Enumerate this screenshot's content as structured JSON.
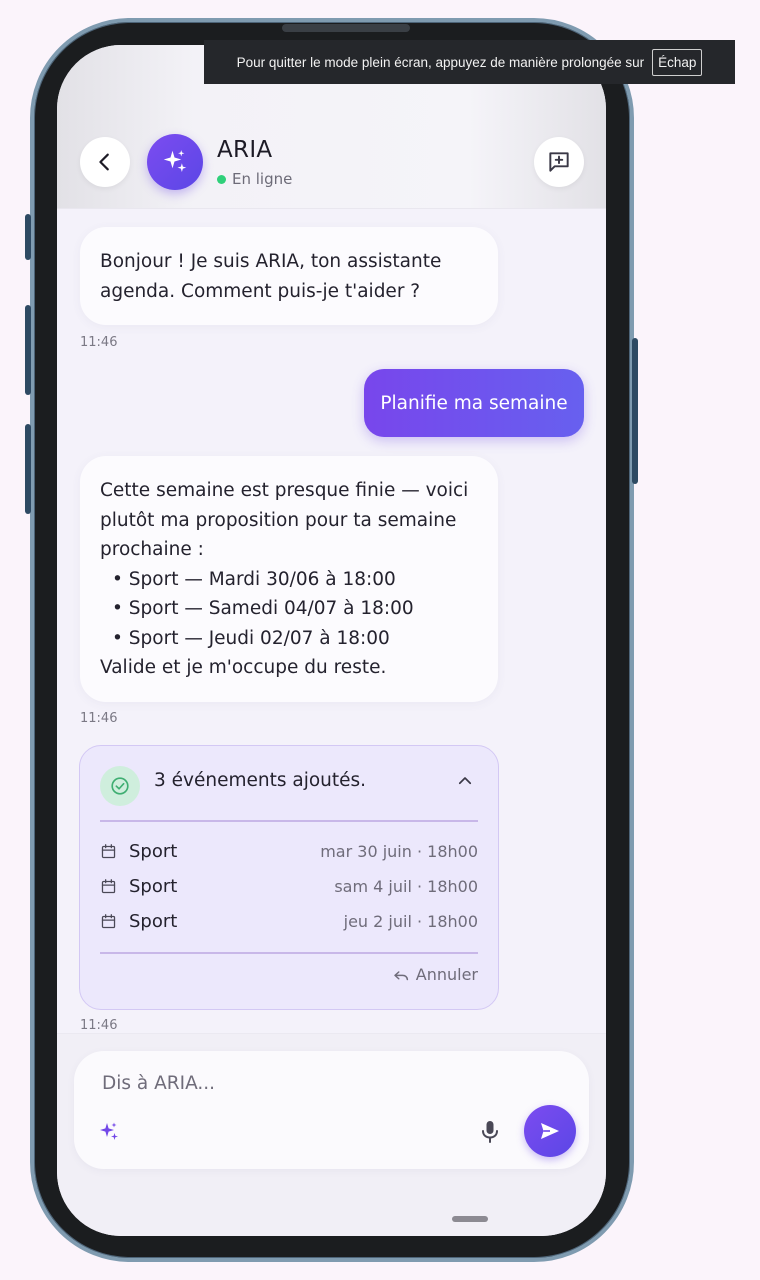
{
  "toast": {
    "message": "Pour quitter le mode plein écran, appuyez de manière prolongée sur",
    "key": "Échap"
  },
  "header": {
    "bot_name": "ARIA",
    "status": "En ligne",
    "back_icon": "chevron-left-icon",
    "new_chat_icon": "add-comment-icon",
    "avatar_icon": "sparkles-icon"
  },
  "messages": {
    "greeting": {
      "text": "Bonjour ! Je suis ARIA, ton assistante agenda. Comment puis-je t'aider ?",
      "time": "11:46"
    },
    "user_request": {
      "text": "Planifie ma semaine"
    },
    "proposal": {
      "intro": "Cette semaine est presque finie — voici plutôt ma proposition pour ta semaine prochaine :",
      "items": [
        "Sport — Mardi 30/06 à 18:00",
        "Sport — Samedi 04/07 à 18:00",
        "Sport — Jeudi 02/07 à 18:00"
      ],
      "outro": "Valide et je m'occupe du reste.",
      "time": "11:46"
    },
    "events_card": {
      "title": "3 événements ajoutés.",
      "events": [
        {
          "name": "Sport",
          "date": "mar 30 juin · 18h00"
        },
        {
          "name": "Sport",
          "date": "sam 4 juil · 18h00"
        },
        {
          "name": "Sport",
          "date": "jeu 2 juil · 18h00"
        }
      ],
      "undo_label": "Annuler",
      "time": "11:46"
    }
  },
  "composer": {
    "placeholder": "Dis à ARIA..."
  },
  "colors": {
    "accent": "#6e48ea",
    "online": "#2fd07a",
    "card_bg": "#ece8fc"
  }
}
